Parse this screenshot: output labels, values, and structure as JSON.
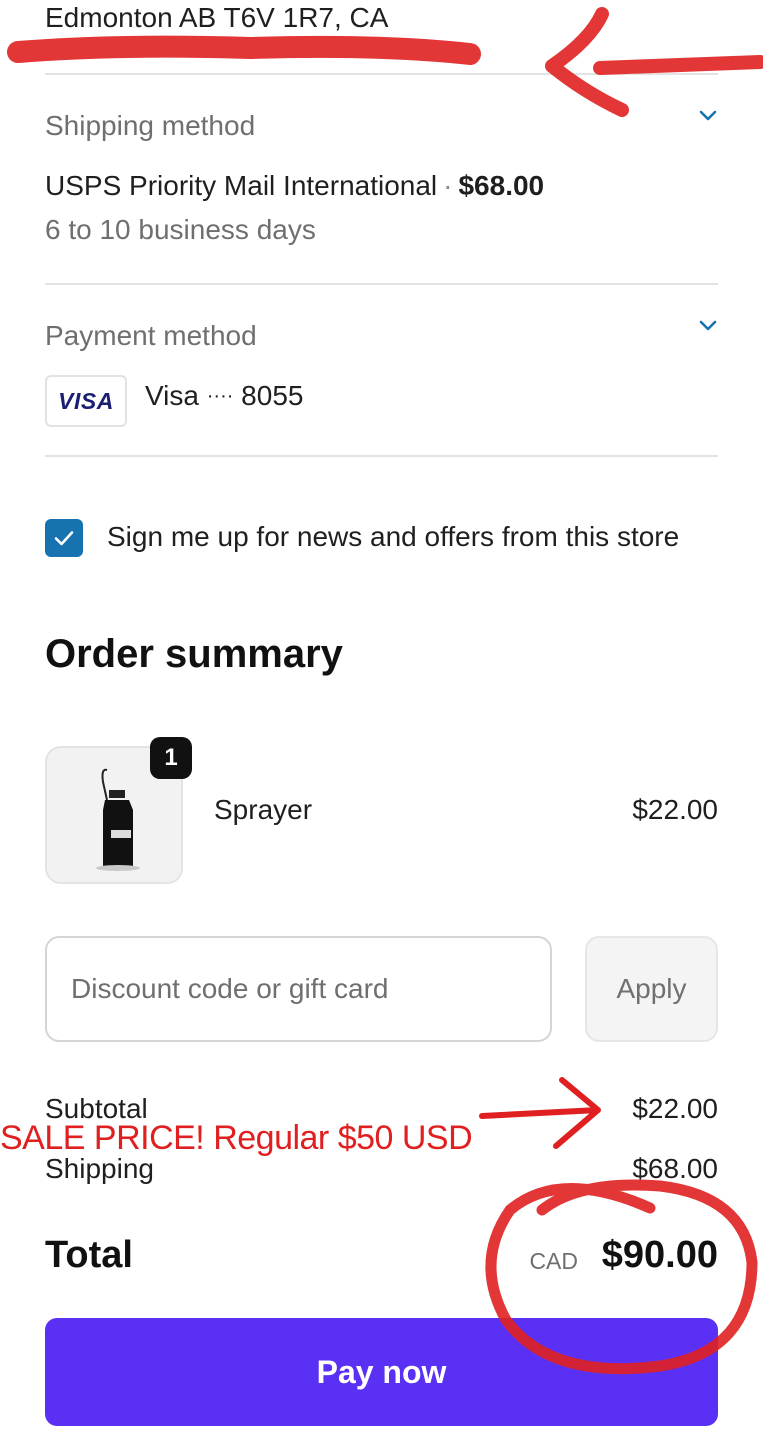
{
  "address": {
    "line": "Edmonton AB T6V 1R7, CA"
  },
  "shipping": {
    "label": "Shipping method",
    "method": "USPS Priority Mail International",
    "separator": "·",
    "price": "$68.00",
    "eta": "6 to 10 business days"
  },
  "payment": {
    "label": "Payment method",
    "card_brand": "VISA",
    "card_name": "Visa",
    "card_mask": "····",
    "card_last4": "8055"
  },
  "newsletter": {
    "checked": true,
    "label": "Sign me up for news and offers from this store"
  },
  "summary": {
    "title": "Order summary",
    "item": {
      "quantity": "1",
      "name": "Sprayer",
      "price": "$22.00",
      "image_brand": "KRINK"
    },
    "discount": {
      "placeholder": "Discount code or gift card",
      "apply_label": "Apply"
    },
    "subtotal": {
      "label": "Subtotal",
      "value": "$22.00"
    },
    "shipping": {
      "label": "Shipping",
      "value": "$68.00"
    },
    "total": {
      "label": "Total",
      "currency": "CAD",
      "value": "$90.00"
    }
  },
  "pay_button": {
    "label": "Pay now"
  },
  "annotation": {
    "text": "SALE PRICE! Regular $50 USD"
  },
  "colors": {
    "accent": "#5a31f4",
    "checkbox": "#1773b0",
    "annotation_red": "#e02020",
    "visa_blue": "#1a1f71"
  },
  "icons": {
    "shipping_expand": "chevron-down-icon",
    "payment_expand": "chevron-down-icon",
    "checkbox": "checkmark-icon"
  }
}
